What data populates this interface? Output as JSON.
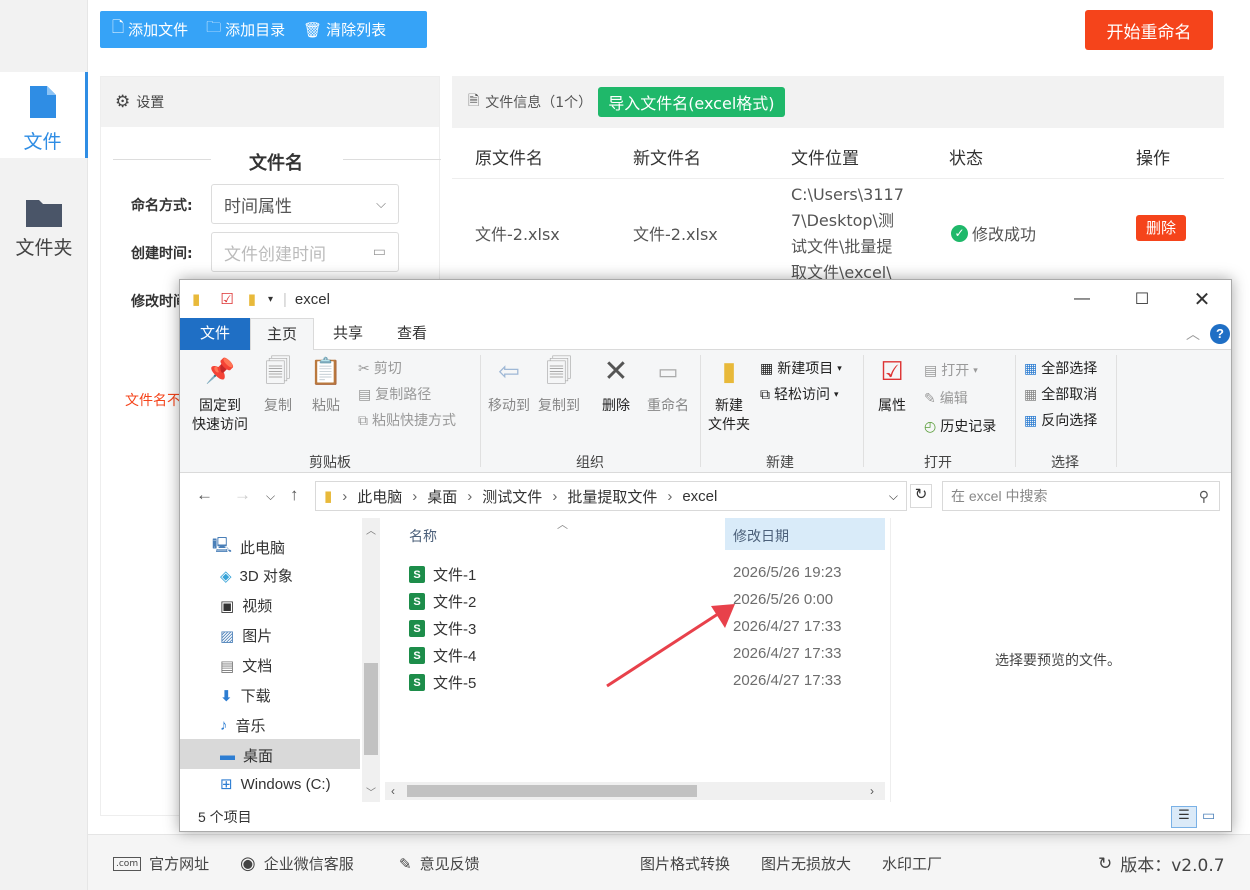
{
  "toolbar": {
    "add_file": "添加文件",
    "add_dir": "添加目录",
    "clear_list": "清除列表",
    "start": "开始重命名"
  },
  "nav": {
    "file": "文件",
    "folder": "文件夹"
  },
  "settings": {
    "title": "设置",
    "section": "文件名",
    "naming_label": "命名方式:",
    "naming_value": "时间属性",
    "create_label": "创建时间:",
    "create_placeholder": "文件创建时间",
    "modify_label": "修改时间",
    "note": "文件名不"
  },
  "fileinfo": {
    "title": "文件信息（1个）",
    "import": "导入文件名(excel格式)",
    "headers": [
      "原文件名",
      "新文件名",
      "文件位置",
      "状态",
      "操作"
    ],
    "row": {
      "orig": "文件-2.xlsx",
      "new": "文件-2.xlsx",
      "path_lines": [
        "C:\\Users\\3117",
        "7\\Desktop\\测",
        "试文件\\批量提",
        "取文件\\excel\\"
      ],
      "status": "修改成功",
      "action": "删除"
    }
  },
  "bottom": {
    "site": "官方网址",
    "wechat": "企业微信客服",
    "feedback": "意见反馈",
    "convert": "图片格式转换",
    "enlarge": "图片无损放大",
    "watermark": "水印工厂",
    "version": "版本：v2.0.7"
  },
  "explorer": {
    "title": "excel",
    "tabs": [
      "文件",
      "主页",
      "共享",
      "查看"
    ],
    "ribbon": {
      "pin": [
        "固定到",
        "快速访问"
      ],
      "copy": "复制",
      "paste": "粘贴",
      "cut": "剪切",
      "copy_path": "复制路径",
      "paste_shortcut": "粘贴快捷方式",
      "clipboard": "剪贴板",
      "move_to": "移动到",
      "copy_to": "复制到",
      "delete": "删除",
      "rename": "重命名",
      "organize": "组织",
      "new_folder": [
        "新建",
        "文件夹"
      ],
      "new_item": "新建项目",
      "easy_access": "轻松访问",
      "new": "新建",
      "properties": "属性",
      "open": "打开",
      "edit": "编辑",
      "history": "历史记录",
      "open_group": "打开",
      "select_all": "全部选择",
      "select_none": "全部取消",
      "invert": "反向选择",
      "select": "选择"
    },
    "breadcrumb": [
      "此电脑",
      "桌面",
      "测试文件",
      "批量提取文件",
      "excel"
    ],
    "search_placeholder": "在 excel 中搜索",
    "nav_items": [
      "此电脑",
      "3D 对象",
      "视频",
      "图片",
      "文档",
      "下载",
      "音乐",
      "桌面",
      "Windows (C:)"
    ],
    "col_name": "名称",
    "col_date": "修改日期",
    "files": [
      {
        "name": "文件-1",
        "date": "2026/5/26 19:23"
      },
      {
        "name": "文件-2",
        "date": "2026/5/26 0:00"
      },
      {
        "name": "文件-3",
        "date": "2026/4/27 17:33"
      },
      {
        "name": "文件-4",
        "date": "2026/4/27 17:33"
      },
      {
        "name": "文件-5",
        "date": "2026/4/27 17:33"
      }
    ],
    "preview_text": "选择要预览的文件。",
    "status": "5 个项目"
  },
  "colors": {
    "blue": "#36a3f7",
    "orange": "#f5441b",
    "green": "#1fb86a",
    "arrow": "#e8414b"
  }
}
